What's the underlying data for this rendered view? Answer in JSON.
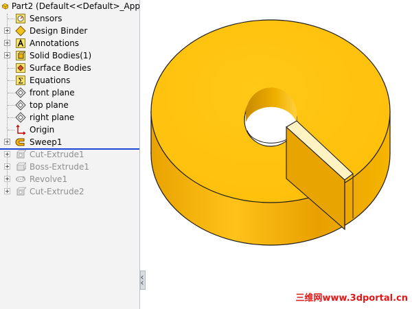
{
  "tree": {
    "header_title": "Part2  (Default<<Default>_App",
    "items": [
      {
        "label": "Sensors",
        "icon": "sensors-icon"
      },
      {
        "label": "Design Binder",
        "icon": "design-binder-icon"
      },
      {
        "label": "Annotations",
        "icon": "annotations-icon"
      },
      {
        "label": "Solid Bodies(1)",
        "icon": "solid-bodies-icon"
      },
      {
        "label": "Surface Bodies",
        "icon": "surface-bodies-icon"
      },
      {
        "label": "Equations",
        "icon": "equations-icon"
      },
      {
        "label": "front plane",
        "icon": "plane-icon"
      },
      {
        "label": "top plane",
        "icon": "plane-icon"
      },
      {
        "label": "right plane",
        "icon": "plane-icon"
      },
      {
        "label": "Origin",
        "icon": "origin-icon"
      },
      {
        "label": "Sweep1",
        "icon": "sweep-icon"
      }
    ],
    "suppressed_items": [
      {
        "label": "Cut-Extrude1",
        "icon": "cut-extrude-icon"
      },
      {
        "label": "Boss-Extrude1",
        "icon": "boss-extrude-icon"
      },
      {
        "label": "Revolve1",
        "icon": "revolve-icon"
      },
      {
        "label": "Cut-Extrude2",
        "icon": "cut-extrude-icon"
      }
    ]
  },
  "viewport": {
    "model_color": "#ffc20e",
    "watermark": "三维网www.3dportal.cn"
  }
}
